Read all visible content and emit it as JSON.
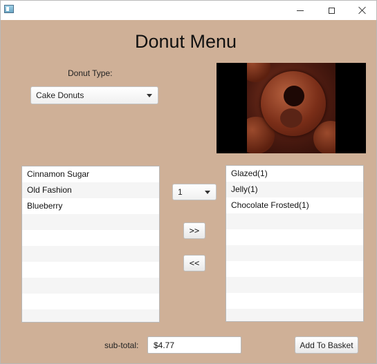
{
  "window": {
    "controls": [
      "minimize",
      "maximize",
      "close"
    ]
  },
  "heading": "Donut Menu",
  "donut_type": {
    "label": "Donut Type:",
    "selected": "Cake Donuts"
  },
  "quantity": {
    "selected": "1"
  },
  "available_list": {
    "items": [
      "Cinnamon Sugar",
      "Old Fashion",
      "Blueberry",
      "",
      "",
      "",
      "",
      "",
      "",
      ""
    ]
  },
  "selected_list": {
    "items": [
      "Glazed(1)",
      "Jelly(1)",
      "Chocolate Frosted(1)",
      "",
      "",
      "",
      "",
      "",
      "",
      ""
    ]
  },
  "buttons": {
    "add": ">>",
    "remove": "<<",
    "add_to_basket": "Add To Basket"
  },
  "subtotal": {
    "label": "sub-total:",
    "value": "$4.77"
  },
  "colors": {
    "background": "#cfb097",
    "list_background": "#ffffff",
    "list_alt_row": "#f5f5f5"
  }
}
